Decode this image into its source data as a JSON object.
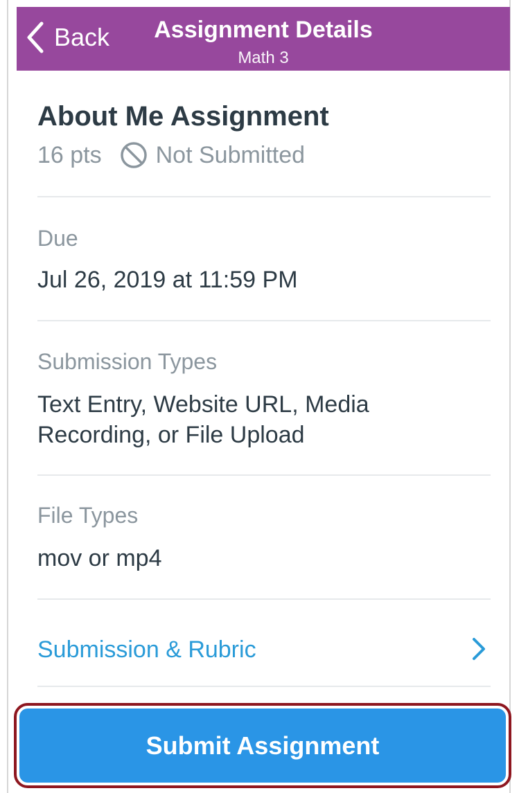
{
  "nav": {
    "back_label": "Back",
    "title": "Assignment Details",
    "subtitle": "Math 3"
  },
  "assignment": {
    "title": "About Me Assignment",
    "points": "16 pts",
    "status": "Not Submitted"
  },
  "details": {
    "due_label": "Due",
    "due_value": "Jul 26, 2019 at 11:59 PM",
    "submission_types_label": "Submission Types",
    "submission_types_value": "Text Entry, Website URL, Media Recording, or File Upload",
    "file_types_label": "File Types",
    "file_types_value": "mov or mp4"
  },
  "link": {
    "label": "Submission & Rubric"
  },
  "submit": {
    "label": "Submit Assignment"
  },
  "colors": {
    "nav_bg": "#97489d",
    "link": "#2a9bd8",
    "button": "#2a95e6",
    "highlight_outline": "#8e1720"
  },
  "icons": {
    "back": "chevron-left-icon",
    "status": "not-submitted-icon",
    "link_chevron": "chevron-right-icon"
  }
}
